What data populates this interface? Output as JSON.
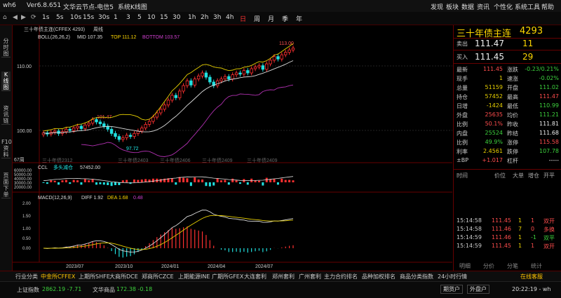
{
  "titlebar": {
    "app": "wh6",
    "version": "Ver6.8.651",
    "node": "文华云节点-电信5",
    "tabs": [
      "系统K线图"
    ],
    "toolbar_right": [
      "发现",
      "板块",
      "数据",
      "资讯",
      "个性化",
      "系统工具",
      "帮助"
    ]
  },
  "toolbar": {
    "periods": [
      "1s",
      "5s",
      "10s",
      "15s",
      "30s",
      "1",
      "3",
      "5",
      "10",
      "15",
      "30",
      "1h",
      "2h",
      "3h",
      "4h",
      "日",
      "周",
      "月",
      "季",
      "年"
    ],
    "active_period": "日"
  },
  "left_tabs": [
    {
      "label": "分时图",
      "active": false
    },
    {
      "label": "K线图",
      "active": true
    },
    {
      "label": "资讯链",
      "active": false
    },
    {
      "label": "F10资料",
      "active": false
    },
    {
      "label": "页面下单",
      "active": false
    }
  ],
  "chart_header": {
    "contract": "三十年债主连(CFFEX 4293)",
    "period": "周线",
    "boll_label": "BOLL(26,26,2)",
    "mid": "MID 107.35",
    "top": "TOP 111.12",
    "bottom": "BOTTOM 103.57"
  },
  "price_axis": {
    "labels": [
      "110.00",
      "100.00"
    ],
    "high_label": "113.00",
    "mid_high": "101.47",
    "low": "97.72"
  },
  "contract_marks": [
    "三十年债2312",
    "三十年债2403",
    "三十年债2406",
    "三十年债2409"
  ],
  "count_label": "67周",
  "ccl": {
    "label": "CCL",
    "sub": "多头减仓",
    "value": "57452.00",
    "axis": [
      "60000.00",
      "50000.00",
      "40000.00",
      "30000.00",
      "20000.00"
    ]
  },
  "macd": {
    "label": "MACD(12,26,9)",
    "diff": "DIFF 1.92",
    "dea": "DEA 1.68",
    "macd": "0.48",
    "axis": [
      "2.00",
      "1.50",
      "1.00",
      "0.50",
      "0.00"
    ]
  },
  "time_axis": [
    "2023/07",
    "2023/10",
    "2024/01",
    "2024/04",
    "2024/07"
  ],
  "chart_data": {
    "type": "candlestick",
    "title": "三十年债主连(CFFEX 4293) 周线",
    "ylim": [
      95,
      114
    ],
    "close": [
      99.0,
      98.8,
      99.1,
      99.3,
      98.9,
      99.2,
      99.6,
      99.4,
      99.8,
      100.1,
      99.7,
      100.3,
      100.6,
      101.2,
      100.8,
      100.5,
      100.1,
      99.6,
      98.9,
      98.4,
      97.9,
      98.2,
      98.6,
      98.4,
      98.9,
      99.3,
      99.8,
      100.4,
      100.9,
      101.6,
      102.3,
      102.9,
      103.6,
      104.4,
      105.2,
      104.8,
      105.9,
      106.8,
      107.6,
      106.9,
      107.9,
      108.4,
      108.9,
      108.2,
      107.4,
      106.8,
      107.6,
      107.9,
      108.3,
      107.9,
      108.6,
      108.9,
      108.7,
      109.3,
      108.9,
      109.6,
      109.9,
      110.1,
      109.5,
      110.4,
      111.0,
      111.6,
      111.2,
      111.9,
      112.3,
      112.7,
      113.0
    ]
  },
  "quote": {
    "name": "三十年债主连",
    "code": "4293",
    "sell_label": "卖出",
    "sell": "111.47",
    "sell_vol": "11",
    "buy_label": "买入",
    "buy": "111.45",
    "buy_vol": "29",
    "rows": [
      {
        "l": "最新",
        "v": "111.45",
        "vc": "red",
        "l2": "涨跌",
        "v2": "-0.23/0.21%",
        "v2c": "green"
      },
      {
        "l": "现手",
        "v": "1",
        "vc": "yel",
        "l2": "速涨",
        "v2": "-0.02%",
        "v2c": "green"
      },
      {
        "l": "总量",
        "v": "51159",
        "vc": "yel",
        "l2": "开盘",
        "v2": "111.02",
        "v2c": "green"
      },
      {
        "l": "持仓",
        "v": "57452",
        "vc": "yel",
        "l2": "最高",
        "v2": "111.47",
        "v2c": "red"
      },
      {
        "l": "日增",
        "v": "-1424",
        "vc": "yel",
        "l2": "最低",
        "v2": "110.99",
        "v2c": "green"
      },
      {
        "l": "外盘",
        "v": "25635",
        "vc": "red",
        "l2": "均价",
        "v2": "111.21",
        "v2c": "green"
      },
      {
        "l": "比例",
        "v": "50.1%",
        "vc": "red",
        "l2": "昨收",
        "v2": "111.81",
        "v2c": "white"
      },
      {
        "l": "内盘",
        "v": "25524",
        "vc": "green",
        "l2": "昨结",
        "v2": "111.68",
        "v2c": "white"
      },
      {
        "l": "比例",
        "v": "49.9%",
        "vc": "green",
        "l2": "涨停",
        "v2": "115.58",
        "v2c": "red"
      },
      {
        "l": "利率",
        "v": "2.4561",
        "vc": "yel",
        "l2": "跌停",
        "v2": "107.78",
        "v2c": "green"
      },
      {
        "l": "±BP",
        "v": "+1.017",
        "vc": "red",
        "l2": "杠杆",
        "v2": "-----",
        "v2c": "white"
      }
    ],
    "tick_header": [
      "时间",
      "价位",
      "大单",
      "增仓",
      "开平"
    ],
    "ticks": [
      {
        "t": "15:14:58",
        "p": "111.45",
        "v": "1",
        "d": "1",
        "k": "双开"
      },
      {
        "t": "15:14:58",
        "p": "111.46",
        "v": "7",
        "d": "0",
        "k": "多换"
      },
      {
        "t": "15:14:59",
        "p": "111.46",
        "v": "1",
        "d": "-1",
        "k": "双平"
      },
      {
        "t": "15:14:59",
        "p": "111.45",
        "v": "1",
        "d": "1",
        "k": "双开"
      }
    ],
    "panel_tabs": [
      "明细",
      "分价",
      "分笔",
      "统计"
    ]
  },
  "bottom_tabs": [
    "行业分类",
    "中金所CFFEX",
    "上期所SHFE",
    "大商所DCE",
    "郑商所CZCE",
    "上期能源INE",
    "广期所GFEX",
    "大连套利",
    "郑州套利",
    "广州套利",
    "主力合约排名",
    "品种加权排名",
    "商品分类指数",
    "24小时行情"
  ],
  "active_bottom_tab": "中金所CFFEX",
  "bottom_right": "在线客服",
  "status": {
    "index1_label": "上证指数",
    "index1": "2862.19 -7.71",
    "index2_label": "文华商品",
    "index2": "172.38 -0.18",
    "btn1": "期货户",
    "btn2": "外盘户",
    "time": "20:22:19 - wh"
  }
}
